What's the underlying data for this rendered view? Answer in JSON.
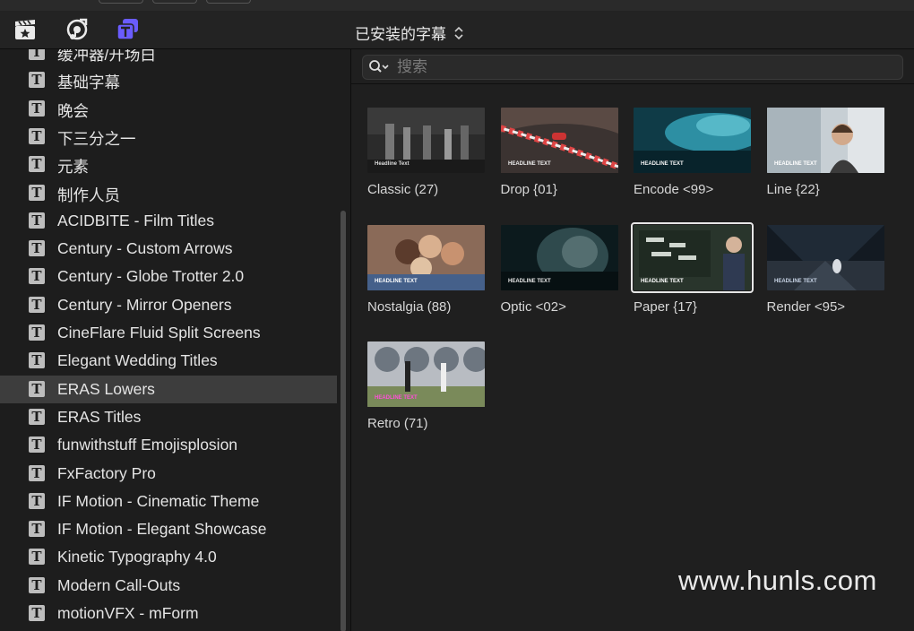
{
  "toolbar": {
    "tools": [
      {
        "icon": "clapper-star-icon"
      },
      {
        "icon": "music-camera-icon"
      },
      {
        "icon": "titles-generators-icon",
        "active": true
      }
    ],
    "title": "已安装的字幕",
    "title_icon": "up-down-chevron-icon"
  },
  "sidebar": {
    "items": [
      {
        "label": "缓冲器/开场白"
      },
      {
        "label": "基础字幕"
      },
      {
        "label": "晚会"
      },
      {
        "label": "下三分之一"
      },
      {
        "label": "元素"
      },
      {
        "label": "制作人员"
      },
      {
        "label": "ACIDBITE - Film Titles"
      },
      {
        "label": "Century - Custom Arrows"
      },
      {
        "label": "Century - Globe Trotter 2.0"
      },
      {
        "label": "Century - Mirror Openers"
      },
      {
        "label": "CineFlare Fluid Split Screens"
      },
      {
        "label": "Elegant Wedding Titles"
      },
      {
        "label": "ERAS Lowers",
        "selected": true
      },
      {
        "label": "ERAS Titles"
      },
      {
        "label": "funwithstuff Emojisplosion"
      },
      {
        "label": "FxFactory Pro"
      },
      {
        "label": "IF Motion - Cinematic Theme"
      },
      {
        "label": "IF Motion - Elegant Showcase"
      },
      {
        "label": "Kinetic Typography 4.0"
      },
      {
        "label": "Modern Call-Outs"
      },
      {
        "label": "motionVFX - mForm"
      }
    ]
  },
  "search": {
    "placeholder": "搜索",
    "value": ""
  },
  "grid": {
    "items": [
      {
        "label": "Classic (27)",
        "caption": "Headline Text"
      },
      {
        "label": "Drop {01}",
        "caption": "HEADLINE TEXT"
      },
      {
        "label": "Encode <99>",
        "caption": "HEADLINE TEXT"
      },
      {
        "label": "Line {22}",
        "caption": "HEADLINE TEXT"
      },
      {
        "label": "Nostalgia (88)",
        "caption": "HEADLINE TEXT"
      },
      {
        "label": "Optic <02>",
        "caption": "HEADLINE TEXT"
      },
      {
        "label": "Paper {17}",
        "caption": "HEADLINE TEXT",
        "selected": true
      },
      {
        "label": "Render <95>",
        "caption": "HEADLINE TEXT"
      },
      {
        "label": "Retro (71)",
        "caption": "HEADLINE TEXT"
      }
    ]
  },
  "watermark": "www.hunls.com",
  "colors": {
    "accent": "#6a5cff",
    "background": "#1e1e1e",
    "selected_row": "#3d3d3d"
  }
}
